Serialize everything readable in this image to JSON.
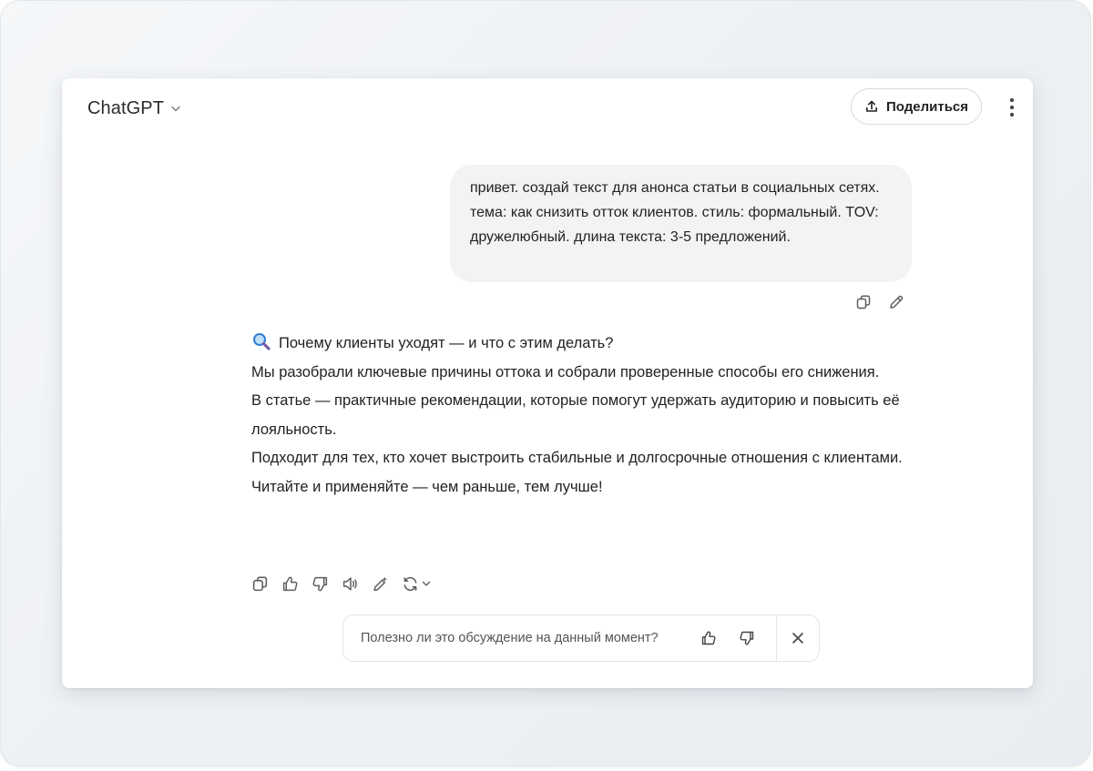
{
  "header": {
    "title": "ChatGPT",
    "share_label": "Поделиться"
  },
  "user_message": {
    "text": "привет. создай текст для анонса статьи в социальных сетях. тема: как снизить отток клиентов. стиль: формальный. TOV: дружелюбный. длина текста: 3-5 предложений."
  },
  "assistant_message": {
    "line1": "Почему клиенты уходят — и что с этим делать?",
    "line2": "Мы разобрали ключевые причины оттока и собрали проверенные способы его снижения.",
    "line3": "В статье — практичные рекомендации, которые помогут удержать аудиторию и повысить её лояльность.",
    "line4": "Подходит для тех, кто хочет выстроить стабильные и долгосрочные отношения с клиентами.",
    "line5": "Читайте и применяйте — чем раньше, тем лучше!"
  },
  "feedback": {
    "question": "Полезно ли это обсуждение на данный момент?"
  },
  "icons": {
    "title_menu": "chevron-down-icon",
    "share": "upload-icon",
    "more": "more-vertical-icon",
    "user_copy": "copy-icon",
    "user_edit": "pencil-icon",
    "emoji": "magnifying-glass-icon",
    "copy": "copy-icon",
    "like": "thumbs-up-icon",
    "dislike": "thumbs-down-icon",
    "read_aloud": "speaker-icon",
    "edit_canvas": "edit-sparkle-icon",
    "regenerate": "refresh-icon",
    "close": "close-icon"
  },
  "colors": {
    "background": "#eef1f4",
    "window": "#ffffff",
    "user_bubble": "#f3f3f3",
    "text": "#222222",
    "icon": "#5d5d5d",
    "emoji_glass": "#2f7fd8"
  }
}
